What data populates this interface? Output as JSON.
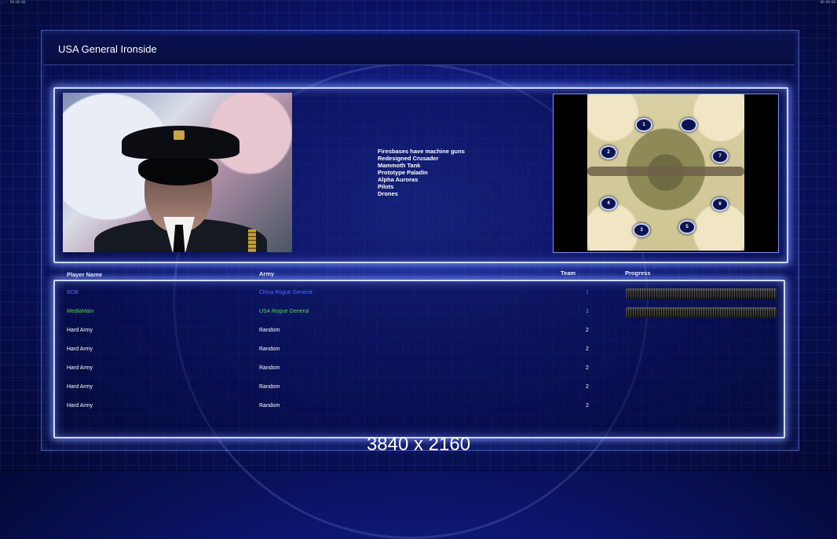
{
  "topbar": {
    "left_text": "…  ⋅⋅  00:00:00",
    "right_text": "00:00:00"
  },
  "title": "USA General Ironside",
  "features": [
    "Firesbases have machine guns",
    "Redesigned Crusader",
    "Mammoth Tank",
    "Prototype Paladin",
    "Alpha Auroras",
    "Pilots",
    "Drones"
  ],
  "minimap": {
    "spots": [
      "1",
      "",
      "2",
      "7",
      "4",
      "6",
      "3",
      "5"
    ]
  },
  "columns": {
    "player": "Player Name",
    "army": "Army",
    "team": "Team",
    "progress": "Progress"
  },
  "players": [
    {
      "name": "BOB",
      "army": "China Rogue General",
      "team": "1",
      "color": "#4b6cff",
      "progress": 0
    },
    {
      "name": "MediaMain",
      "army": "USA Rogue General",
      "team": "1",
      "color": "#4ed84e",
      "progress": 0
    },
    {
      "name": "Hard Army",
      "army": "Random",
      "team": "2",
      "color": "#ffffff"
    },
    {
      "name": "Hard Army",
      "army": "Random",
      "team": "2",
      "color": "#ffffff"
    },
    {
      "name": "Hard Army",
      "army": "Random",
      "team": "2",
      "color": "#ffffff"
    },
    {
      "name": "Hard Army",
      "army": "Random",
      "team": "2",
      "color": "#ffffff"
    },
    {
      "name": "Hard Army",
      "army": "Random",
      "team": "2",
      "color": "#ffffff"
    }
  ],
  "resolution_label": "3840 x 2160"
}
